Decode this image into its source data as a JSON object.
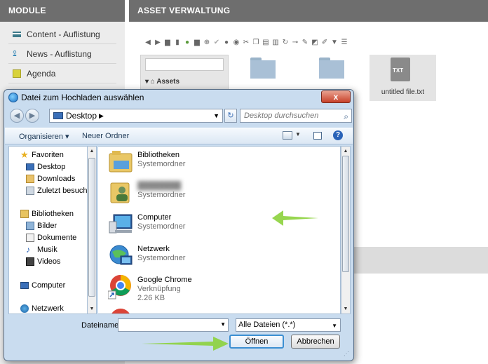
{
  "cms": {
    "modules_header": "MODULE",
    "modules": [
      {
        "label": "Content - Auflistung",
        "icon": "list-icon"
      },
      {
        "label": "News - Auflistung",
        "icon": "antenna-icon"
      },
      {
        "label": "Agenda",
        "icon": "calendar-icon"
      }
    ],
    "asset_header": "ASSET VERWALTUNG",
    "tree_root": "Assets",
    "file_tile": {
      "name": "untitled file.txt",
      "badge": "TXT"
    },
    "toolbar_icons": [
      "arrow-left-icon",
      "arrow-right-icon",
      "folder-icon",
      "file-icon",
      "upload-icon",
      "folder-open-icon",
      "add-icon",
      "check-icon",
      "info-icon",
      "eye-icon",
      "cut-icon",
      "copy-icon",
      "paste-icon",
      "delete-icon",
      "refresh-icon",
      "link-icon",
      "edit-icon",
      "share-icon",
      "pencil-icon",
      "filter-icon",
      "list-icon"
    ]
  },
  "dialog": {
    "title": "Datei zum Hochladen auswählen",
    "close_label": "x",
    "address": "Desktop",
    "search_placeholder": "Desktop durchsuchen",
    "commands": {
      "organize": "Organisieren",
      "new_folder": "Neuer Ordner"
    },
    "nav": {
      "favorites": "Favoriten",
      "favorites_items": [
        "Desktop",
        "Downloads",
        "Zuletzt besucht"
      ],
      "libraries": "Bibliotheken",
      "libraries_items": [
        "Bilder",
        "Dokumente",
        "Musik",
        "Videos"
      ],
      "computer": "Computer",
      "network": "Netzwerk"
    },
    "files": [
      {
        "name": "Bibliotheken",
        "type": "Systemordner",
        "icon": "library-folder-icon"
      },
      {
        "name": "",
        "type": "Systemordner",
        "icon": "user-folder-icon"
      },
      {
        "name": "Computer",
        "type": "Systemordner",
        "icon": "computer-icon"
      },
      {
        "name": "Netzwerk",
        "type": "Systemordner",
        "icon": "network-icon"
      },
      {
        "name": "Google Chrome",
        "type": "Verknüpfung",
        "size": "2.26 KB",
        "icon": "chrome-icon"
      }
    ],
    "filename_label": "Dateiname:",
    "filename_value": "",
    "filter_value": "Alle Dateien (*.*)",
    "open_label": "Öffnen",
    "cancel_label": "Abbrechen"
  },
  "colors": {
    "highlight_arrow": "#8cd23c",
    "header_bg": "#6e6e6e",
    "dialog_frame": "#c9dcef"
  }
}
